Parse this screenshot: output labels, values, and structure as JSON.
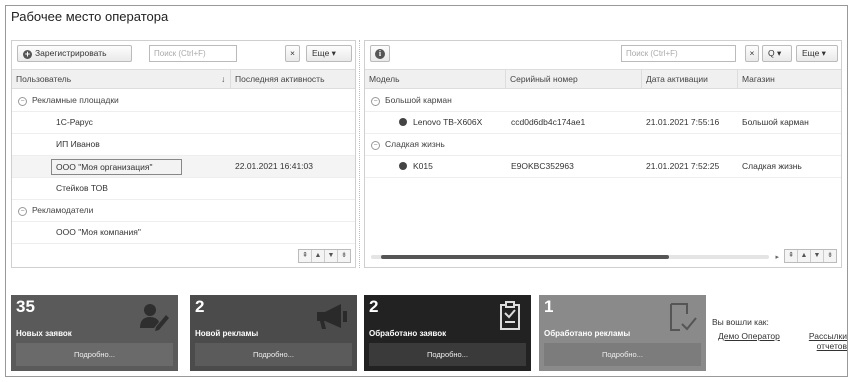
{
  "window": {
    "title": "Рабочее место оператора"
  },
  "users_panel": {
    "register_button": "Зарегистрировать",
    "search_placeholder": "Поиск (Ctrl+F)",
    "clear_label": "×",
    "more_button": "Еще",
    "columns": {
      "user": "Пользователь",
      "sort": "↓",
      "last_activity": "Последняя активность"
    },
    "groups": [
      {
        "name": "Рекламные площадки",
        "items": [
          {
            "name": "1С-Рарус",
            "activity": ""
          },
          {
            "name": "ИП Иванов",
            "activity": ""
          },
          {
            "name": "ООО \"Моя организация\"",
            "activity": "22.01.2021 16:41:03",
            "selected": true
          },
          {
            "name": "Стейков ТОВ",
            "activity": ""
          }
        ]
      },
      {
        "name": "Рекламодатели",
        "items": [
          {
            "name": "ООО \"Моя компания\"",
            "activity": ""
          }
        ]
      }
    ]
  },
  "devices_panel": {
    "search_placeholder": "Поиск (Ctrl+F)",
    "clear_label": "×",
    "search_button": "Q",
    "more_button": "Еще",
    "columns": {
      "model": "Модель",
      "serial": "Серийный номер",
      "activation": "Дата активации",
      "shop": "Магазин"
    },
    "groups": [
      {
        "name": "Большой карман",
        "items": [
          {
            "model": "Lenovo TB-X606X",
            "serial": "ccd0d6db4c174ae1",
            "activation": "21.01.2021 7:55:16",
            "shop": "Большой карман"
          }
        ]
      },
      {
        "name": "Сладкая жизнь",
        "items": [
          {
            "model": "K015",
            "serial": "E9OKBC352963",
            "activation": "21.01.2021 7:52:25",
            "shop": "Сладкая жизнь"
          }
        ]
      }
    ]
  },
  "tiles": [
    {
      "count": "35",
      "label": "Новых заявок",
      "more": "Подробно...",
      "icon": "user-edit-icon",
      "color": "#5a5a5a"
    },
    {
      "count": "2",
      "label": "Новой рекламы",
      "more": "Подробно...",
      "icon": "megaphone-icon",
      "color": "#4b4b4b"
    },
    {
      "count": "2",
      "label": "Обработано заявок",
      "more": "Подробно...",
      "icon": "clipboard-check-icon",
      "color": "#222222"
    },
    {
      "count": "1",
      "label": "Обработано рекламы",
      "more": "Подробно...",
      "icon": "document-check-icon",
      "color": "#8a8a8a"
    }
  ],
  "login": {
    "label": "Вы вошли как:",
    "user": "Демо Оператор",
    "reports": "Рассылки отчетов"
  }
}
